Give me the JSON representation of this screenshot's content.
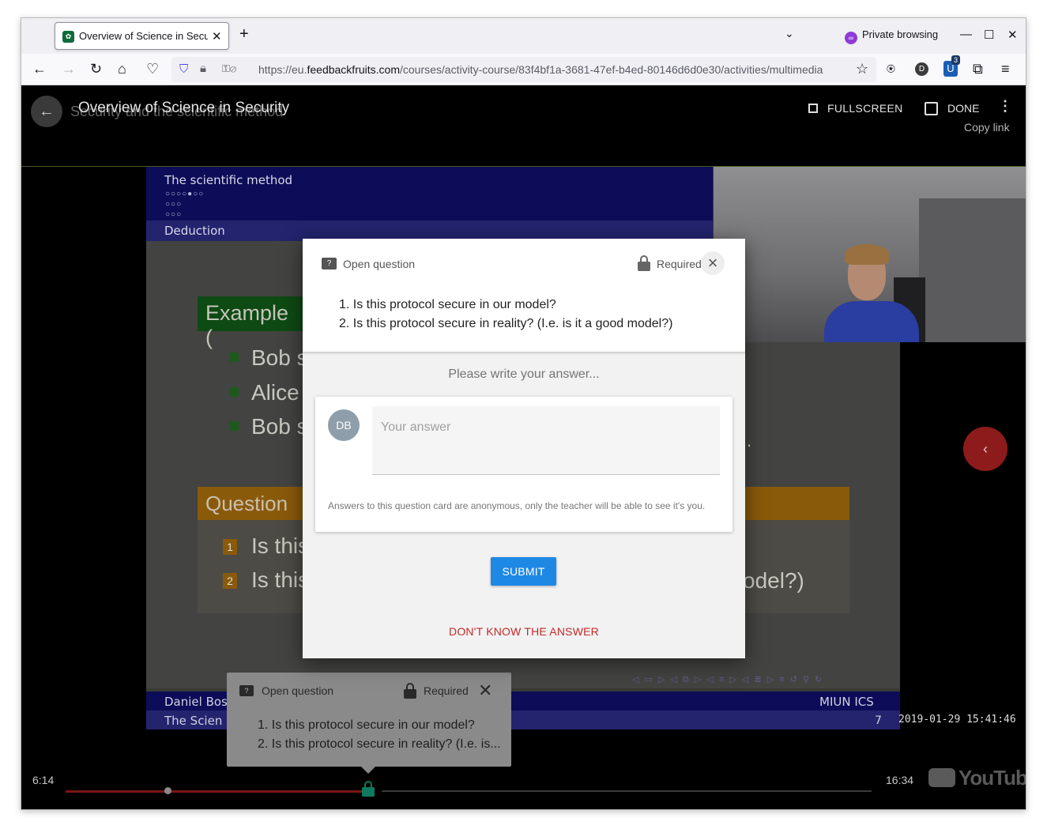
{
  "browser": {
    "tab_title": "Overview of Science in Secu",
    "private_label": "Private browsing",
    "url_prefix": "https://eu.",
    "url_domain": "feedbackfruits.com",
    "url_path": "/courses/activity-course/83f4bf1a-3681-47ef-b4ed-80146d6d0e30/activities/multimedia",
    "extension_badge": "3",
    "account_initial": "D"
  },
  "header": {
    "title": "Overview of Science in Security",
    "subtitle": "Security and the scientific method",
    "fullscreen_label": "FULLSCREEN",
    "done_label": "DONE",
    "copy_link_label": "Copy link"
  },
  "slide": {
    "section": "The scientific method",
    "nav_dots": "○○○○●○○\n○○○\n○○○",
    "subsection": "Deduction",
    "example_title": "Example (",
    "bullets": [
      "Bob s",
      "Alice",
      "Bob s"
    ],
    "question_title": "Question",
    "question_items": [
      {
        "num": "1",
        "text": "Is this"
      },
      {
        "num": "2",
        "text": "Is this"
      }
    ],
    "question_tail": "odel?)",
    "dot": ".",
    "nav_symbols": "◁ ▭ ▷ ◁ ⧉ ▷ ◁ ≡ ▷ ◁ ≣ ▷ ≡ ↺ ⚲ ↻",
    "footer_author": "Daniel Bos",
    "footer_org": "MIUN ICS",
    "footer_title": "The Scien",
    "footer_page": "7",
    "timestamp": "2019-01-29 15:41:46"
  },
  "player": {
    "current_time": "6:14",
    "duration": "16:34",
    "progress_fraction": 0.377,
    "youtube_label": "YouTube"
  },
  "tooltip": {
    "type_label": "Open question",
    "required_label": "Required",
    "q1": "1. Is this protocol secure in our model?",
    "q2": "2. Is this protocol secure in reality? (I.e. is..."
  },
  "modal": {
    "type_label": "Open question",
    "required_label": "Required",
    "q1": "1. Is this protocol secure in our model?",
    "q2": "2. Is this protocol secure in reality? (I.e. is it a good model?)",
    "prompt": "Please write your answer...",
    "avatar_initials": "DB",
    "answer_placeholder": "Your answer",
    "anon_note": "Answers to this question card are anonymous, only the teacher will be able to see it's you.",
    "submit_label": "SUBMIT",
    "dont_know_label": "DON'T KNOW THE ANSWER"
  },
  "colors": {
    "submit": "#1e88e5",
    "dont_know": "#c62828",
    "lock_marker": "#0e7a5e",
    "private_purple": "#8f3bd6"
  }
}
